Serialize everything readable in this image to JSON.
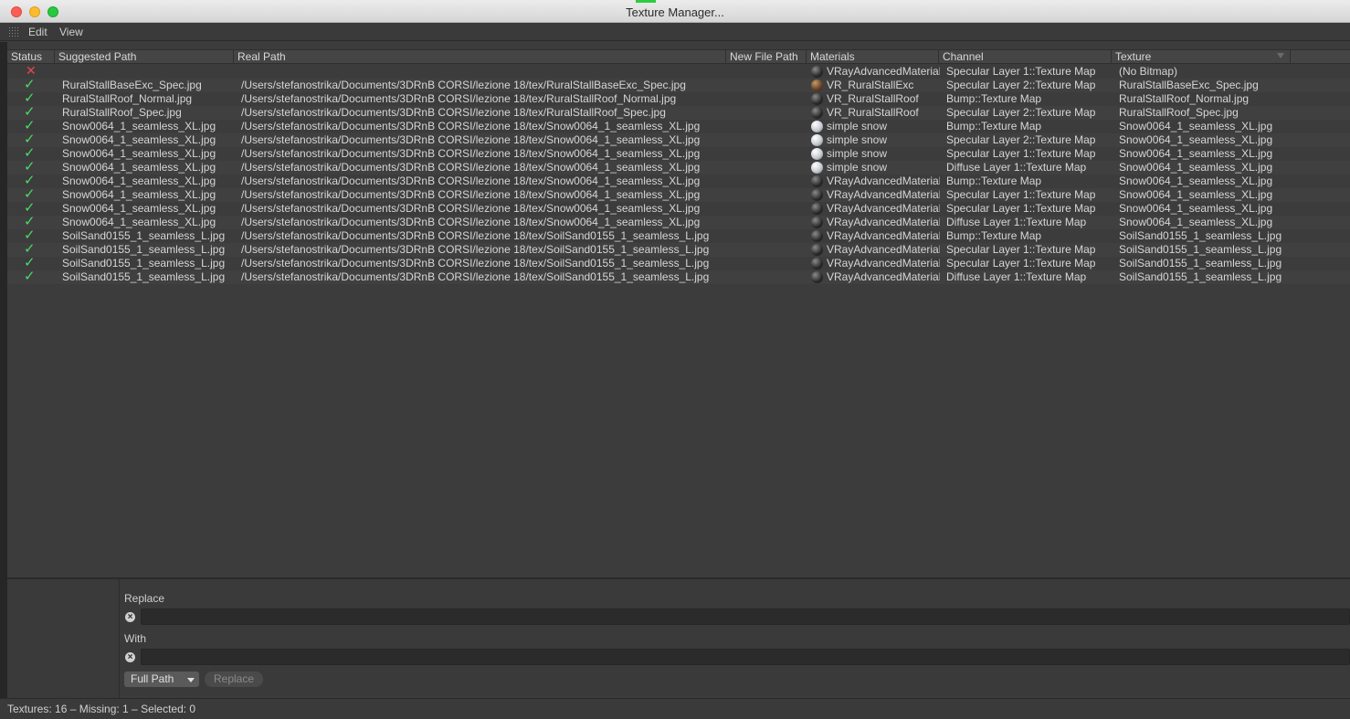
{
  "window": {
    "title": "Texture Manager..."
  },
  "menu": {
    "edit": "Edit",
    "view": "View"
  },
  "columns": {
    "status": "Status",
    "suggested": "Suggested Path",
    "real": "Real Path",
    "new": "New File Path",
    "materials": "Materials",
    "channel": "Channel",
    "texture": "Texture"
  },
  "rows": [
    {
      "status": "missing",
      "suggested": "",
      "real": "",
      "material": "VRayAdvancedMaterial",
      "ball": "dark",
      "channel": "Specular Layer 1::Texture Map",
      "texture": "(No Bitmap)"
    },
    {
      "status": "ok",
      "suggested": "RuralStallBaseExc_Spec.jpg",
      "real": "/Users/stefanostrika/Documents/3DRnB CORSI/lezione 18/tex/RuralStallBaseExc_Spec.jpg",
      "material": "VR_RuralStallExc",
      "ball": "wood",
      "channel": "Specular Layer 2::Texture Map",
      "texture": "RuralStallBaseExc_Spec.jpg"
    },
    {
      "status": "ok",
      "suggested": "RuralStallRoof_Normal.jpg",
      "real": "/Users/stefanostrika/Documents/3DRnB CORSI/lezione 18/tex/RuralStallRoof_Normal.jpg",
      "material": "VR_RuralStallRoof",
      "ball": "dark",
      "channel": "Bump::Texture Map",
      "texture": "RuralStallRoof_Normal.jpg"
    },
    {
      "status": "ok",
      "suggested": "RuralStallRoof_Spec.jpg",
      "real": "/Users/stefanostrika/Documents/3DRnB CORSI/lezione 18/tex/RuralStallRoof_Spec.jpg",
      "material": "VR_RuralStallRoof",
      "ball": "dark",
      "channel": "Specular Layer 2::Texture Map",
      "texture": "RuralStallRoof_Spec.jpg"
    },
    {
      "status": "ok",
      "suggested": "Snow0064_1_seamless_XL.jpg",
      "real": "/Users/stefanostrika/Documents/3DRnB CORSI/lezione 18/tex/Snow0064_1_seamless_XL.jpg",
      "material": "simple snow",
      "ball": "snow",
      "channel": "Bump::Texture Map",
      "texture": "Snow0064_1_seamless_XL.jpg"
    },
    {
      "status": "ok",
      "suggested": "Snow0064_1_seamless_XL.jpg",
      "real": "/Users/stefanostrika/Documents/3DRnB CORSI/lezione 18/tex/Snow0064_1_seamless_XL.jpg",
      "material": "simple snow",
      "ball": "snow",
      "channel": "Specular Layer 2::Texture Map",
      "texture": "Snow0064_1_seamless_XL.jpg"
    },
    {
      "status": "ok",
      "suggested": "Snow0064_1_seamless_XL.jpg",
      "real": "/Users/stefanostrika/Documents/3DRnB CORSI/lezione 18/tex/Snow0064_1_seamless_XL.jpg",
      "material": "simple snow",
      "ball": "snow",
      "channel": "Specular Layer 1::Texture Map",
      "texture": "Snow0064_1_seamless_XL.jpg"
    },
    {
      "status": "ok",
      "suggested": "Snow0064_1_seamless_XL.jpg",
      "real": "/Users/stefanostrika/Documents/3DRnB CORSI/lezione 18/tex/Snow0064_1_seamless_XL.jpg",
      "material": "simple snow",
      "ball": "snow",
      "channel": "Diffuse Layer 1::Texture Map",
      "texture": "Snow0064_1_seamless_XL.jpg"
    },
    {
      "status": "ok",
      "suggested": "Snow0064_1_seamless_XL.jpg",
      "real": "/Users/stefanostrika/Documents/3DRnB CORSI/lezione 18/tex/Snow0064_1_seamless_XL.jpg",
      "material": "VRayAdvancedMaterial",
      "ball": "dark",
      "channel": "Bump::Texture Map",
      "texture": "Snow0064_1_seamless_XL.jpg"
    },
    {
      "status": "ok",
      "suggested": "Snow0064_1_seamless_XL.jpg",
      "real": "/Users/stefanostrika/Documents/3DRnB CORSI/lezione 18/tex/Snow0064_1_seamless_XL.jpg",
      "material": "VRayAdvancedMaterial",
      "ball": "dark",
      "channel": "Specular Layer 1::Texture Map",
      "texture": "Snow0064_1_seamless_XL.jpg"
    },
    {
      "status": "ok",
      "suggested": "Snow0064_1_seamless_XL.jpg",
      "real": "/Users/stefanostrika/Documents/3DRnB CORSI/lezione 18/tex/Snow0064_1_seamless_XL.jpg",
      "material": "VRayAdvancedMaterial",
      "ball": "dark",
      "channel": "Specular Layer 1::Texture Map",
      "texture": "Snow0064_1_seamless_XL.jpg"
    },
    {
      "status": "ok",
      "suggested": "Snow0064_1_seamless_XL.jpg",
      "real": "/Users/stefanostrika/Documents/3DRnB CORSI/lezione 18/tex/Snow0064_1_seamless_XL.jpg",
      "material": "VRayAdvancedMaterial",
      "ball": "dark",
      "channel": "Diffuse Layer 1::Texture Map",
      "texture": "Snow0064_1_seamless_XL.jpg"
    },
    {
      "status": "ok",
      "suggested": "SoilSand0155_1_seamless_L.jpg",
      "real": "/Users/stefanostrika/Documents/3DRnB CORSI/lezione 18/tex/SoilSand0155_1_seamless_L.jpg",
      "material": "VRayAdvancedMaterial",
      "ball": "dark",
      "channel": "Bump::Texture Map",
      "texture": "SoilSand0155_1_seamless_L.jpg"
    },
    {
      "status": "ok",
      "suggested": "SoilSand0155_1_seamless_L.jpg",
      "real": "/Users/stefanostrika/Documents/3DRnB CORSI/lezione 18/tex/SoilSand0155_1_seamless_L.jpg",
      "material": "VRayAdvancedMaterial",
      "ball": "dark",
      "channel": "Specular Layer 1::Texture Map",
      "texture": "SoilSand0155_1_seamless_L.jpg"
    },
    {
      "status": "ok",
      "suggested": "SoilSand0155_1_seamless_L.jpg",
      "real": "/Users/stefanostrika/Documents/3DRnB CORSI/lezione 18/tex/SoilSand0155_1_seamless_L.jpg",
      "material": "VRayAdvancedMaterial",
      "ball": "dark",
      "channel": "Specular Layer 1::Texture Map",
      "texture": "SoilSand0155_1_seamless_L.jpg"
    },
    {
      "status": "ok",
      "suggested": "SoilSand0155_1_seamless_L.jpg",
      "real": "/Users/stefanostrika/Documents/3DRnB CORSI/lezione 18/tex/SoilSand0155_1_seamless_L.jpg",
      "material": "VRayAdvancedMaterial",
      "ball": "dark",
      "channel": "Diffuse Layer 1::Texture Map",
      "texture": "SoilSand0155_1_seamless_L.jpg"
    }
  ],
  "replace_panel": {
    "replace_label": "Replace",
    "with_label": "With",
    "replace_value": "",
    "with_value": "",
    "mode_selected": "Full Path",
    "replace_button": "Replace"
  },
  "status_bar": {
    "text": "Textures: 16 – Missing: 1 – Selected: 0"
  },
  "colors": {
    "ok": "#4cd964",
    "missing": "#e8464a"
  },
  "icons": {
    "ok": "check-icon",
    "missing": "cross-icon"
  }
}
